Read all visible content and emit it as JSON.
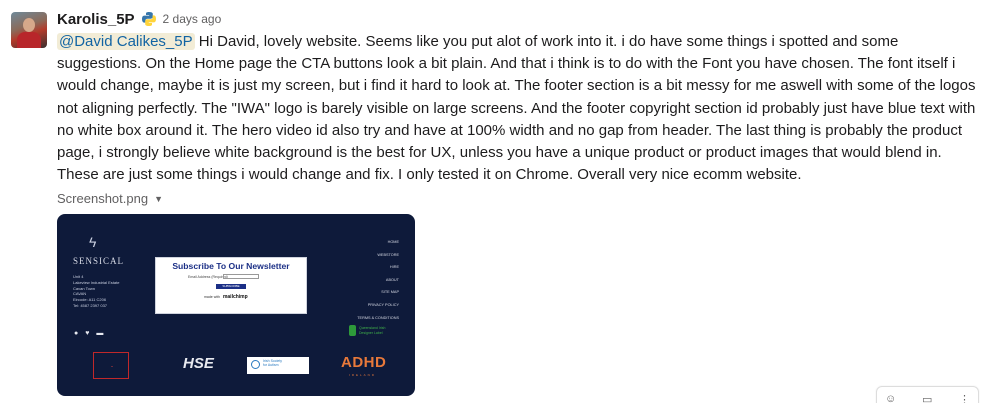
{
  "message": {
    "username": "Karolis_5P",
    "timestamp": "2 days ago",
    "mention": "@David Calikes_5P",
    "text": " Hi David, lovely website. Seems like you put alot of work into it. i do have some things i spotted and some suggestions. On the Home page the CTA buttons look a bit plain. And that i think is to do with the Font you have chosen. The font itself i would change, maybe it is just my screen, but i find it hard to look at. The footer section is a bit messy for me aswell with some of the logos not aligning perfectly. The \"IWA\" logo is barely visible on large screens. And the footer copyright section id probably just have blue text with no white box around it. The hero video id also try and have at 100% width and no gap from header. The last thing is probably the product page, i strongly believe white background is the best for UX, unless you have a unique product or product images that would blend in. These are just some things i would change and fix. I only tested it on Chrome. Overall very nice ecomm website.",
    "status_icon": "python-icon"
  },
  "attachment": {
    "file_name": "Screenshot.png",
    "preview": {
      "brand": "SENSICAL",
      "address_lines": [
        "Unit 4",
        "Lakeview Industrial Estate",
        "Cavan Town",
        "CAVAN",
        "Eircode: A11 C206",
        "Tel: 4587 2397 037"
      ],
      "newsletter": {
        "title": "Subscribe To Our Newsletter",
        "email_label": "Email Address (Required)",
        "button": "SUBSCRIBE",
        "made_with": "made with",
        "provider": "mailchimp"
      },
      "nav_links": [
        "HOME",
        "WEBSTORE",
        "HIRE",
        "ABOUT",
        "SITE MAP",
        "PRIVACY POLICY",
        "TERMS & CONDITIONS"
      ],
      "green_badge": [
        "Queensland Irish",
        "Designer Label"
      ],
      "partners": {
        "hse": "HSE",
        "autism": [
          "Irish Society",
          "for Autism"
        ],
        "adhd": "ADHD",
        "adhd_sub": "IRELAND"
      }
    }
  }
}
